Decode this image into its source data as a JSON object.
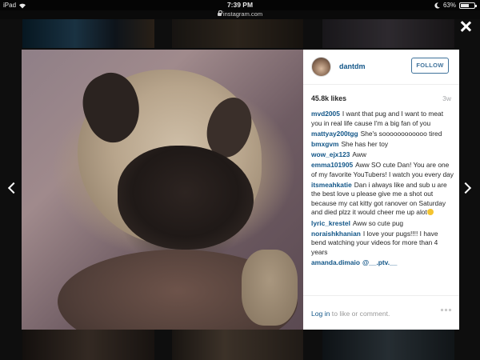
{
  "status_bar": {
    "device": "iPad",
    "time": "7:39 PM",
    "battery": "63%",
    "battery_level": 0.63,
    "url": "instagram.com"
  },
  "modal": {
    "username": "dantdm",
    "follow_label": "FOLLOW",
    "likes": "45.8k likes",
    "age": "3w",
    "comments": [
      {
        "user": "mvd2005",
        "text": "I want that pug and I want to meat you in real life cause I'm a big fan of you"
      },
      {
        "user": "mattyay200tgg",
        "text": "She's soooooooooooo tired"
      },
      {
        "user": "bmxgvm",
        "text": "She has her toy"
      },
      {
        "user": "wow_ejx123",
        "text": "Aww"
      },
      {
        "user": "emma101905",
        "text": "Aww SO cute Dan! You are one of my favorite YouTubers! I watch you every day"
      },
      {
        "user": "itsmeahkatie",
        "text": "Dan i always like and sub u are the best love u please give me a shot out because my cat kitty got ranover on Saturday and died plzz it would cheer me up alot"
      },
      {
        "user": "lyric_krestel",
        "text": "Aww so cute pug"
      },
      {
        "user": "noraishkhanian",
        "text": "I love your pugs!!!! I have bend watching your videos for more than 4 years"
      },
      {
        "user": "amanda.dimaio",
        "text": "@__.ptv.__"
      }
    ],
    "login_link": "Log in",
    "login_suffix": " to like or comment."
  }
}
